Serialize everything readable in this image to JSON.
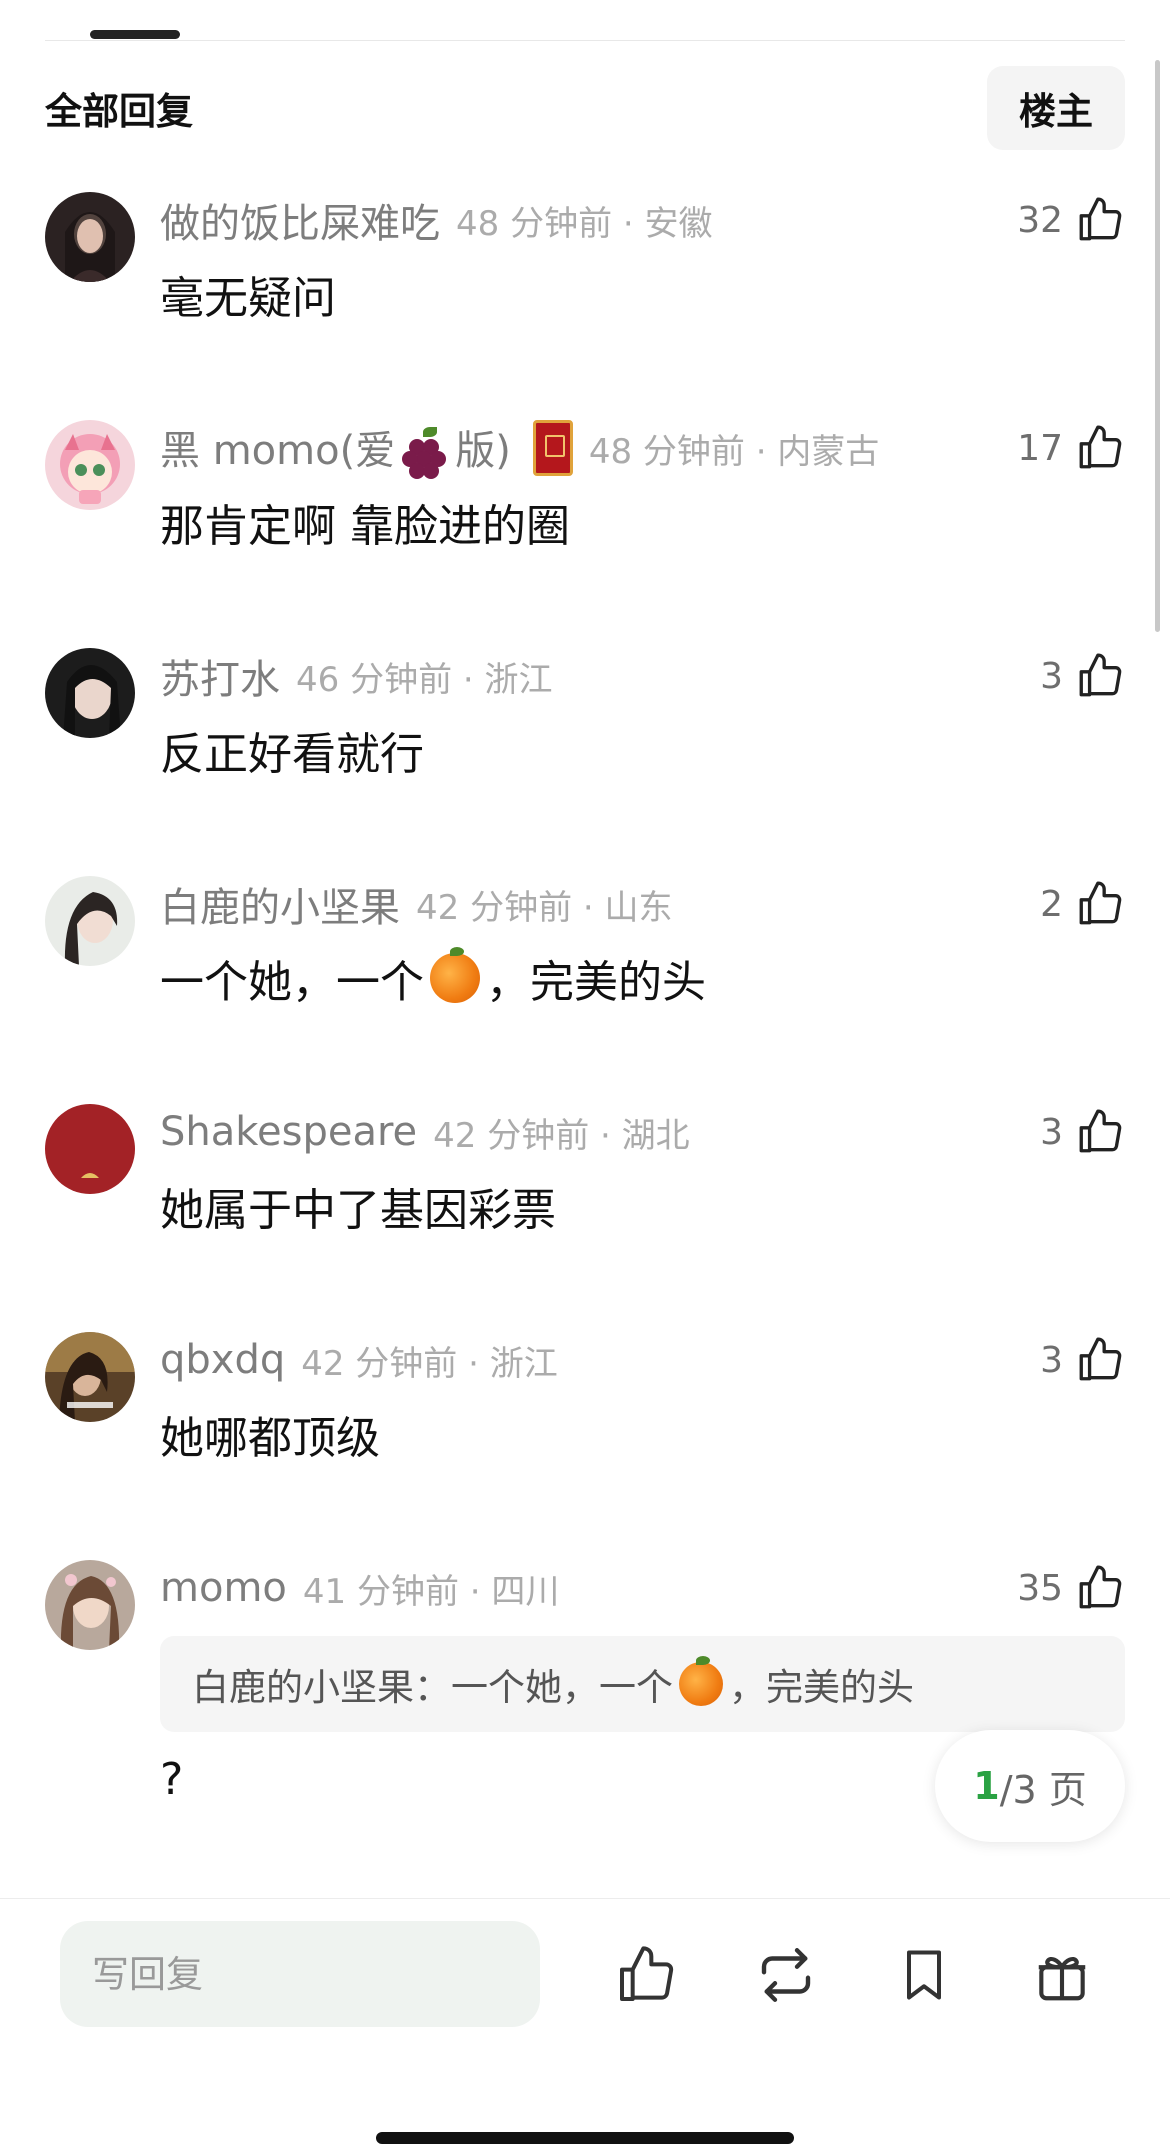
{
  "header": {
    "title": "全部回复",
    "op_button": "楼主"
  },
  "comments": [
    {
      "username": "做的饭比屎难吃",
      "time": "48 分钟前 · 安徽",
      "likes": "32",
      "text": "毫无疑问"
    },
    {
      "username_prefix": "黑 momo(爱",
      "username_suffix": "版)",
      "time": "48 分钟前 · 内蒙古",
      "likes": "17",
      "text": "那肯定啊 靠脸进的圈",
      "emoji": "grapes-emoji",
      "badge": "red-fan-badge"
    },
    {
      "username": "苏打水",
      "time": "46 分钟前 · 浙江",
      "likes": "3",
      "text": "反正好看就行"
    },
    {
      "username": "白鹿的小坚果",
      "time": "42 分钟前 · 山东",
      "likes": "2",
      "text_before": "一个她，一个",
      "text_after": "，完美的头",
      "emoji": "orange-emoji"
    },
    {
      "username": "Shakespeare",
      "time": "42 分钟前 · 湖北",
      "likes": "3",
      "text": "她属于中了基因彩票"
    },
    {
      "username": "qbxdq",
      "time": "42 分钟前 · 浙江",
      "likes": "3",
      "text": "她哪都顶级"
    },
    {
      "username": "momo",
      "time": "41 分钟前 · 四川",
      "likes": "35",
      "quote_before": "白鹿的小坚果：一个她，一个",
      "quote_after": "，完美的头",
      "text": "?"
    }
  ],
  "pagination": {
    "current": "1",
    "rest": "/3 页"
  },
  "bottom_bar": {
    "reply_placeholder": "写回复",
    "icons": [
      "thumbs-up-icon",
      "repost-icon",
      "bookmark-icon",
      "gift-icon"
    ]
  },
  "colors": {
    "accent": "#2aa243",
    "meta_gray": "#ababab",
    "name_gray": "#7d7d7d"
  }
}
